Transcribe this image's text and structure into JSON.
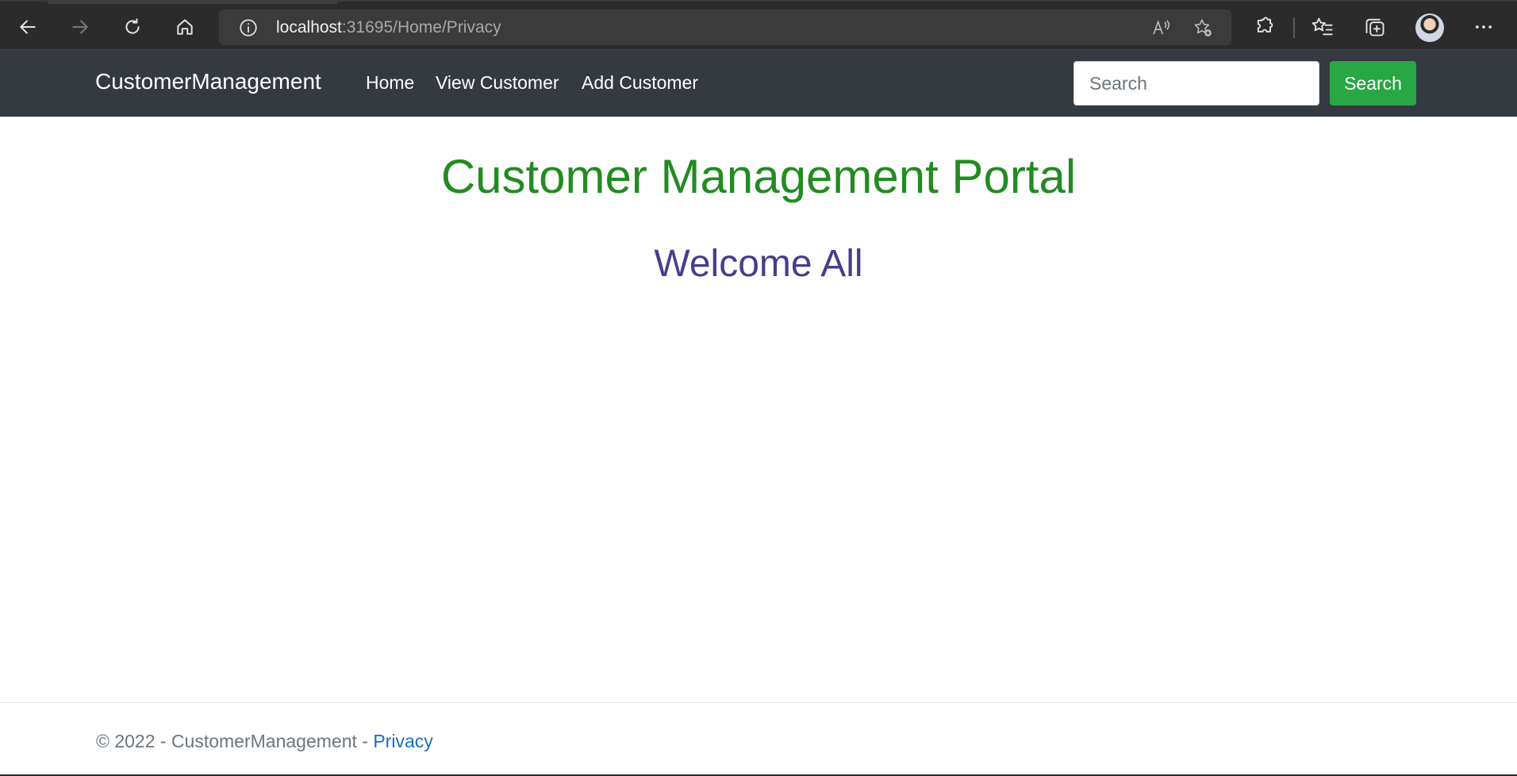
{
  "browser": {
    "url_host": "localhost",
    "url_path": ":31695/Home/Privacy",
    "icons": [
      "back-arrow-icon",
      "forward-arrow-icon",
      "refresh-icon",
      "home-icon",
      "info-icon",
      "read-aloud-icon",
      "add-favorite-icon",
      "extensions-icon",
      "favorites-icon",
      "collections-icon",
      "profile-avatar",
      "more-icon"
    ]
  },
  "navbar": {
    "brand": "CustomerManagement",
    "links": [
      {
        "label": "Home"
      },
      {
        "label": "View Customer"
      },
      {
        "label": "Add Customer"
      }
    ],
    "search_placeholder": "Search",
    "search_button": "Search",
    "background": "#343a40",
    "button_color": "#28a745"
  },
  "main": {
    "title": "Customer Management Portal",
    "subtitle": "Welcome All",
    "title_color": "#228b22",
    "subtitle_color": "#483d8b"
  },
  "footer": {
    "copyright": "© 2022 - CustomerManagement - ",
    "privacy_link": "Privacy",
    "link_color": "#1b6ec2"
  }
}
